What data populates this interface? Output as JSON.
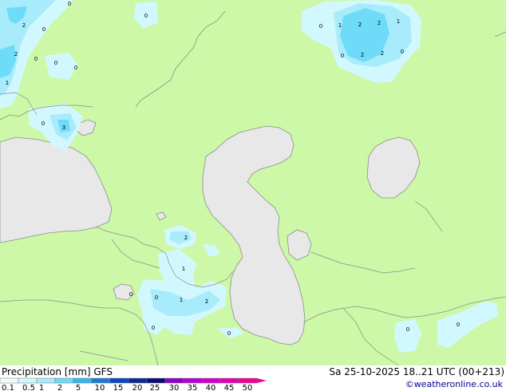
{
  "header": {
    "title": "Precipitation [mm]  GFS",
    "valid_time": "Sa 25-10-2025 18..21 UTC (00+213)",
    "credit": "©weatheronline.co.uk"
  },
  "colors": {
    "land": "#ccf8a8",
    "water": "#e8e8e8",
    "border": "#8c8c8c",
    "precip_light": "#d2f8ff",
    "precip_medium": "#a8ecfc",
    "precip_heavy": "#6edcf8"
  },
  "precip_values": [
    {
      "v": "0"
    },
    {
      "v": "0"
    },
    {
      "v": "2"
    },
    {
      "v": "0"
    },
    {
      "v": "2"
    },
    {
      "v": "0"
    },
    {
      "v": "0"
    },
    {
      "v": "0"
    },
    {
      "v": "1"
    },
    {
      "v": "0"
    },
    {
      "v": "3"
    },
    {
      "v": "0"
    },
    {
      "v": "1"
    },
    {
      "v": "2"
    },
    {
      "v": "2"
    },
    {
      "v": "1"
    },
    {
      "v": "0"
    },
    {
      "v": "2"
    },
    {
      "v": "2"
    },
    {
      "v": "0"
    },
    {
      "v": "2"
    },
    {
      "v": "0"
    },
    {
      "v": "1"
    },
    {
      "v": "0"
    },
    {
      "v": "1"
    },
    {
      "v": "2"
    },
    {
      "v": "0"
    },
    {
      "v": "0"
    },
    {
      "v": "0"
    },
    {
      "v": "0"
    }
  ],
  "legend": {
    "ticks": [
      "0.1",
      "0.5",
      "1",
      "2",
      "5",
      "10",
      "15",
      "20",
      "25",
      "30",
      "35",
      "40",
      "45",
      "50"
    ],
    "colors": [
      "#f0fcfc",
      "#d2f8ff",
      "#a8ecfc",
      "#6edcf8",
      "#38b4f0",
      "#1e78d8",
      "#0a46c0",
      "#0a2896",
      "#0a0a78",
      "#8c00c8",
      "#b400d2",
      "#d200d2",
      "#e600b4",
      "#f00096"
    ]
  }
}
